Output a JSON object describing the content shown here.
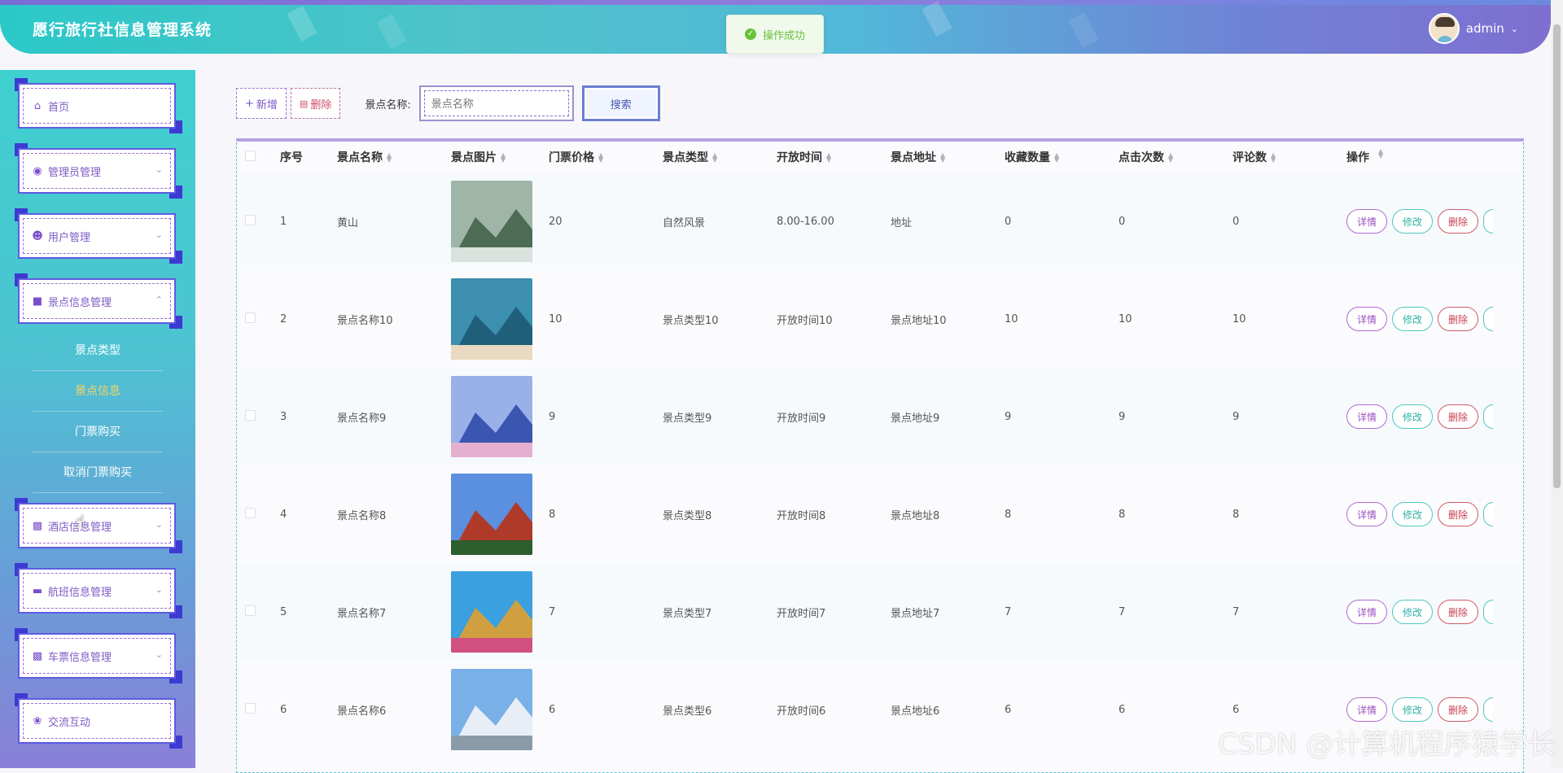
{
  "header": {
    "app_title": "愿行旅行社信息管理系统",
    "username": "admin",
    "toast": "操作成功"
  },
  "sidebar": {
    "items": [
      {
        "label": "首页",
        "icon": "home-icon"
      },
      {
        "label": "管理员管理",
        "icon": "admin-icon"
      },
      {
        "label": "用户管理",
        "icon": "user-icon"
      },
      {
        "label": "景点信息管理",
        "icon": "scenic-icon"
      },
      {
        "label": "酒店信息管理",
        "icon": "hotel-icon"
      },
      {
        "label": "航班信息管理",
        "icon": "flight-icon"
      },
      {
        "label": "车票信息管理",
        "icon": "ticket-icon"
      },
      {
        "label": "交流互动",
        "icon": "forum-icon"
      }
    ],
    "submenu": [
      "景点类型",
      "景点信息",
      "门票购买",
      "取消门票购买"
    ],
    "active_submenu": "景点信息"
  },
  "toolbar": {
    "add_label": "新增",
    "delete_label": "删除",
    "search_label": "景点名称:",
    "search_placeholder": "景点名称",
    "search_button": "搜索"
  },
  "table": {
    "columns": [
      "序号",
      "景点名称",
      "景点图片",
      "门票价格",
      "景点类型",
      "开放时间",
      "景点地址",
      "收藏数量",
      "点击次数",
      "评论数",
      "操作"
    ],
    "rows": [
      {
        "idx": "1",
        "name": "黄山",
        "price": "20",
        "type": "自然风景",
        "time": "8.00-16.00",
        "addr": "地址",
        "fav": "0",
        "click": "0",
        "cmt": "0",
        "img_theme": "mountain"
      },
      {
        "idx": "2",
        "name": "景点名称10",
        "price": "10",
        "type": "景点类型10",
        "time": "开放时间10",
        "addr": "景点地址10",
        "fav": "10",
        "click": "10",
        "cmt": "10",
        "img_theme": "lighthouse"
      },
      {
        "idx": "3",
        "name": "景点名称9",
        "price": "9",
        "type": "景点类型9",
        "time": "开放时间9",
        "addr": "景点地址9",
        "fav": "9",
        "click": "9",
        "cmt": "9",
        "img_theme": "lake"
      },
      {
        "idx": "4",
        "name": "景点名称8",
        "price": "8",
        "type": "景点类型8",
        "time": "开放时间8",
        "addr": "景点地址8",
        "fav": "8",
        "click": "8",
        "cmt": "8",
        "img_theme": "temple"
      },
      {
        "idx": "5",
        "name": "景点名称7",
        "price": "7",
        "type": "景点类型7",
        "time": "开放时间7",
        "addr": "景点地址7",
        "fav": "7",
        "click": "7",
        "cmt": "7",
        "img_theme": "statue"
      },
      {
        "idx": "6",
        "name": "景点名称6",
        "price": "6",
        "type": "景点类型6",
        "time": "开放时间6",
        "addr": "景点地址6",
        "fav": "6",
        "click": "6",
        "cmt": "6",
        "img_theme": "gate"
      }
    ],
    "op_labels": {
      "detail": "详情",
      "edit": "修改",
      "delete": "删除"
    }
  },
  "watermark": "CSDN @计算机程序猿学长"
}
